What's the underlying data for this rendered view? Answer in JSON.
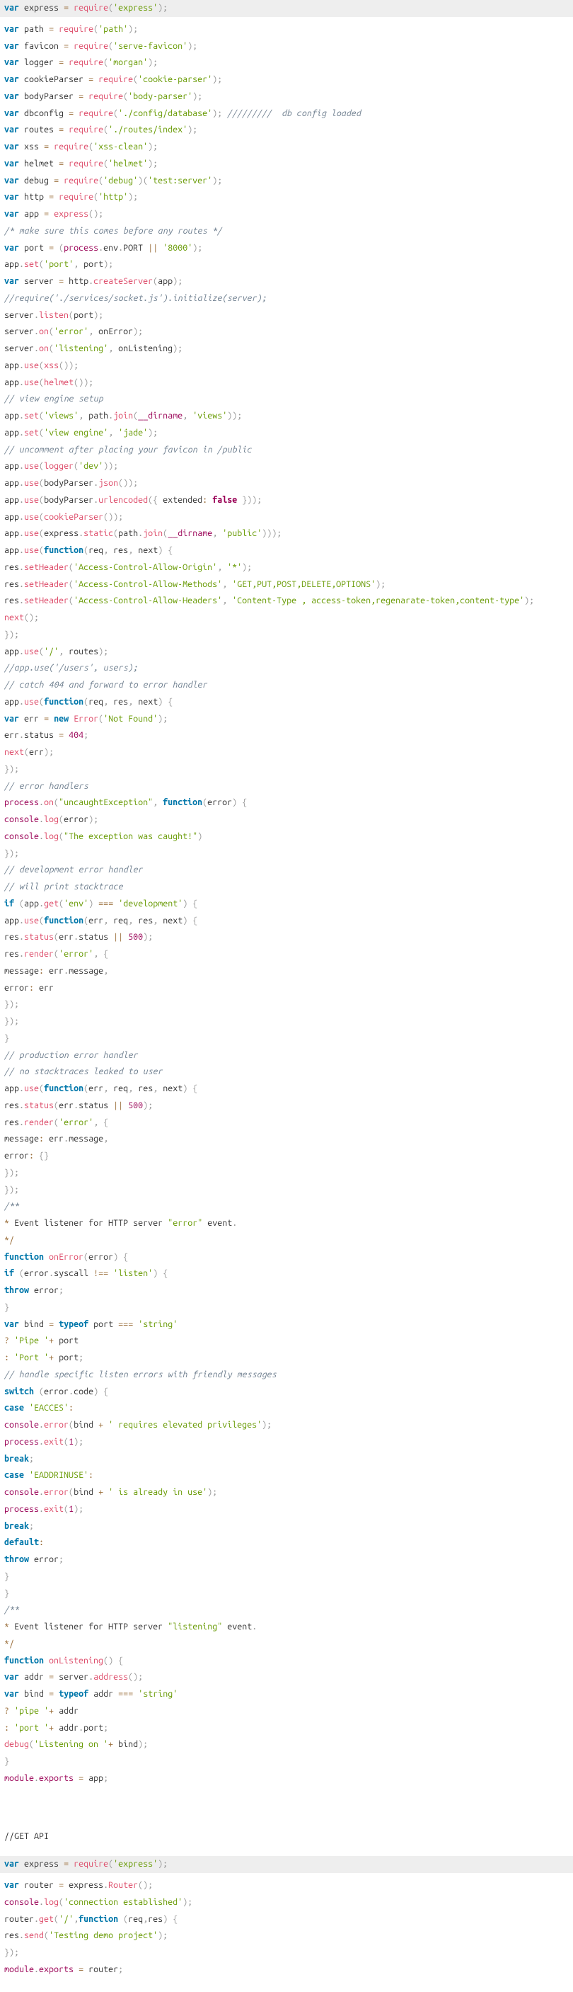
{
  "block1_highlight": "var express = require('express');",
  "block1_lines": [
    "var path = require('path');",
    "var favicon = require('serve-favicon');",
    "var logger = require('morgan');",
    "var cookieParser = require('cookie-parser');",
    "var bodyParser = require('body-parser');",
    "var dbconfig = require('./config/database'); /////////  db config loaded",
    "var routes = require('./routes/index');",
    "var xss = require('xss-clean');",
    "var helmet = require('helmet');",
    "var debug = require('debug')('test:server');",
    "var http = require('http');",
    "var app = express();",
    "/* make sure this comes before any routes */",
    "var port = (process.env.PORT || '8000');",
    "app.set('port', port);",
    "var server = http.createServer(app);",
    "//require('./services/socket.js').initialize(server);",
    "server.listen(port);",
    "server.on('error', onError);",
    "server.on('listening', onListening);",
    "app.use(xss());",
    "app.use(helmet());",
    "// view engine setup",
    "app.set('views', path.join(__dirname, 'views'));",
    "app.set('view engine', 'jade');",
    "// uncomment after placing your favicon in /public",
    "app.use(logger('dev'));",
    "app.use(bodyParser.json());",
    "app.use(bodyParser.urlencoded({ extended: false }));",
    "app.use(cookieParser());",
    "app.use(express.static(path.join(__dirname, 'public')));",
    "app.use(function(req, res, next) {",
    "res.setHeader('Access-Control-Allow-Origin', '*');",
    "res.setHeader('Access-Control-Allow-Methods', 'GET,PUT,POST,DELETE,OPTIONS');",
    "res.setHeader('Access-Control-Allow-Headers', 'Content-Type , access-token,regenarate-token,content-type');",
    "next();",
    "});",
    "app.use('/', routes);",
    "//app.use('/users', users);",
    "// catch 404 and forward to error handler",
    "app.use(function(req, res, next) {",
    "var err = new Error('Not Found');",
    "err.status = 404;",
    "next(err);",
    "});",
    "// error handlers",
    "process.on(\"uncaughtException\", function(error) {",
    "console.log(error);",
    "console.log(\"The exception was caught!\")",
    "});",
    "// development error handler",
    "// will print stacktrace",
    "if (app.get('env') === 'development') {",
    "app.use(function(err, req, res, next) {",
    "res.status(err.status || 500);",
    "res.render('error', {",
    "message: err.message,",
    "error: err",
    "});",
    "});",
    "}",
    "// production error handler",
    "// no stacktraces leaked to user",
    "app.use(function(err, req, res, next) {",
    "res.status(err.status || 500);",
    "res.render('error', {",
    "message: err.message,",
    "error: {}",
    "});",
    "});",
    "/**",
    "* Event listener for HTTP server \"error\" event.",
    "*/",
    "function onError(error) {",
    "if (error.syscall !== 'listen') {",
    "throw error;",
    "}",
    "var bind = typeof port === 'string'",
    "? 'Pipe '+ port",
    ": 'Port '+ port;",
    "// handle specific listen errors with friendly messages",
    "switch (error.code) {",
    "case 'EACCES':",
    "console.error(bind + ' requires elevated privileges');",
    "process.exit(1);",
    "break;",
    "case 'EADDRINUSE':",
    "console.error(bind + ' is already in use');",
    "process.exit(1);",
    "break;",
    "default:",
    "throw error;",
    "}",
    "}",
    "/**",
    "* Event listener for HTTP server \"listening\" event.",
    "*/",
    "function onListening() {",
    "var addr = server.address();",
    "var bind = typeof addr === 'string'",
    "? 'pipe '+ addr",
    ": 'port '+ addr.port;",
    "debug('Listening on '+ bind);",
    "}",
    "module.exports = app;"
  ],
  "heading": "//GET API",
  "block2_highlight": "var express = require('express');",
  "block2_lines": [
    "var router = express.Router();",
    "console.log('connection established');",
    "router.get('/',function (req,res) {",
    "res.send('Testing demo project');",
    "});",
    "module.exports = router;"
  ]
}
